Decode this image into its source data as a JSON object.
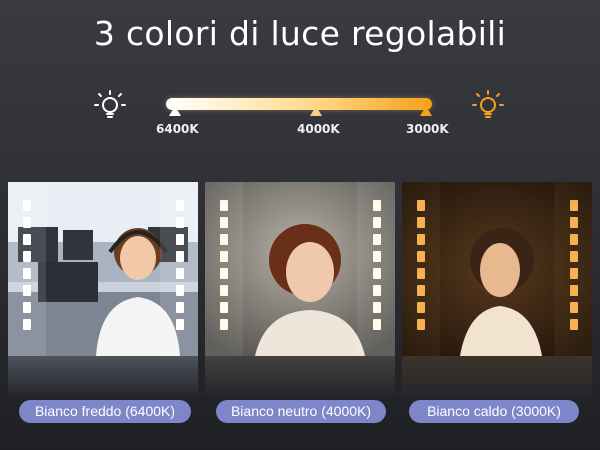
{
  "title": "3 colori di luce regolabili",
  "slider": {
    "ticks": [
      "6400K",
      "4000K",
      "3000K"
    ],
    "icons": {
      "left": "bulb-cold-icon",
      "right": "bulb-warm-icon"
    },
    "colors": {
      "cold": "#ffffff",
      "neutral": "#f5d089",
      "warm": "#f6a21a"
    }
  },
  "panels": [
    {
      "label": "Bianco freddo (6400K)",
      "tone": "cold"
    },
    {
      "label": "Bianco neutro (4000K)",
      "tone": "neutral"
    },
    {
      "label": "Bianco caldo (3000K)",
      "tone": "warm"
    }
  ],
  "accent": "#7c86c9"
}
